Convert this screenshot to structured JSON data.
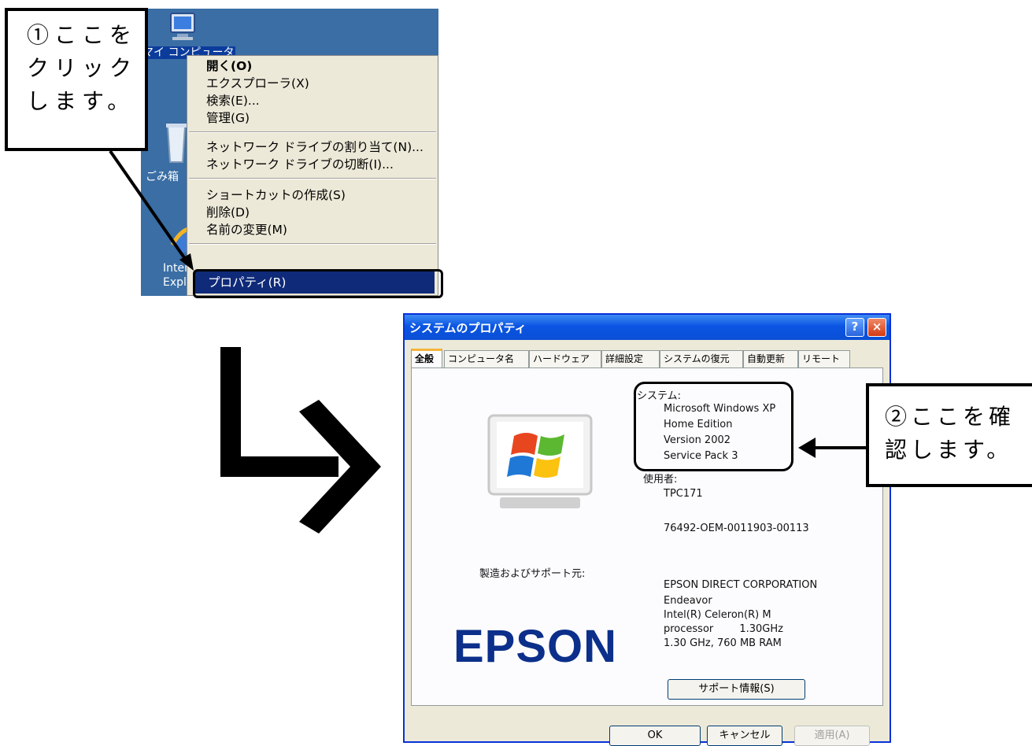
{
  "desktop": {
    "labels": [
      "マイ コンピュータ",
      "ごみ箱",
      "Internet",
      "Explorer"
    ]
  },
  "context_menu": {
    "items": [
      {
        "label": "開く(O)",
        "bold": true
      },
      {
        "label": "エクスプローラ(X)"
      },
      {
        "label": "検索(E)..."
      },
      {
        "label": "管理(G)"
      },
      {
        "label": "ネットワーク ドライブの割り当て(N)..."
      },
      {
        "label": "ネットワーク ドライブの切断(I)..."
      },
      {
        "label": "ショートカットの作成(S)"
      },
      {
        "label": "削除(D)"
      },
      {
        "label": "名前の変更(M)"
      },
      {
        "label": "プロパティ(R)",
        "selected": true
      }
    ]
  },
  "callouts": {
    "step1": [
      "①ここを",
      "クリック",
      "します。"
    ],
    "step2": [
      "②ここを確",
      "認します。"
    ]
  },
  "dialog": {
    "title": "システムのプロパティ",
    "help": "?",
    "close": "×",
    "tabs": [
      "全般",
      "コンピュータ名",
      "ハードウェア",
      "詳細設定",
      "システムの復元",
      "自動更新",
      "リモート"
    ],
    "active_tab": 0,
    "system_heading": "システム:",
    "system_lines": [
      "Microsoft Windows XP",
      "Home Edition",
      "Version 2002",
      "Service Pack 3"
    ],
    "user_heading": "使用者:",
    "user_name": "TPC171",
    "product_id": "76492-OEM-0011903-00113",
    "manufacturer_heading": "製造およびサポート元:",
    "manufacturer_logo": "EPSON",
    "manufacturer_lines": [
      "EPSON DIRECT CORPORATION",
      "Endeavor",
      "Intel(R) Celeron(R) M",
      "processor        1.30GHz",
      "1.30 GHz, 760 MB RAM"
    ],
    "support_button": "サポート情報(S)",
    "ok_button": "OK",
    "cancel_button": "キャンセル",
    "apply_button": "適用(A)"
  }
}
